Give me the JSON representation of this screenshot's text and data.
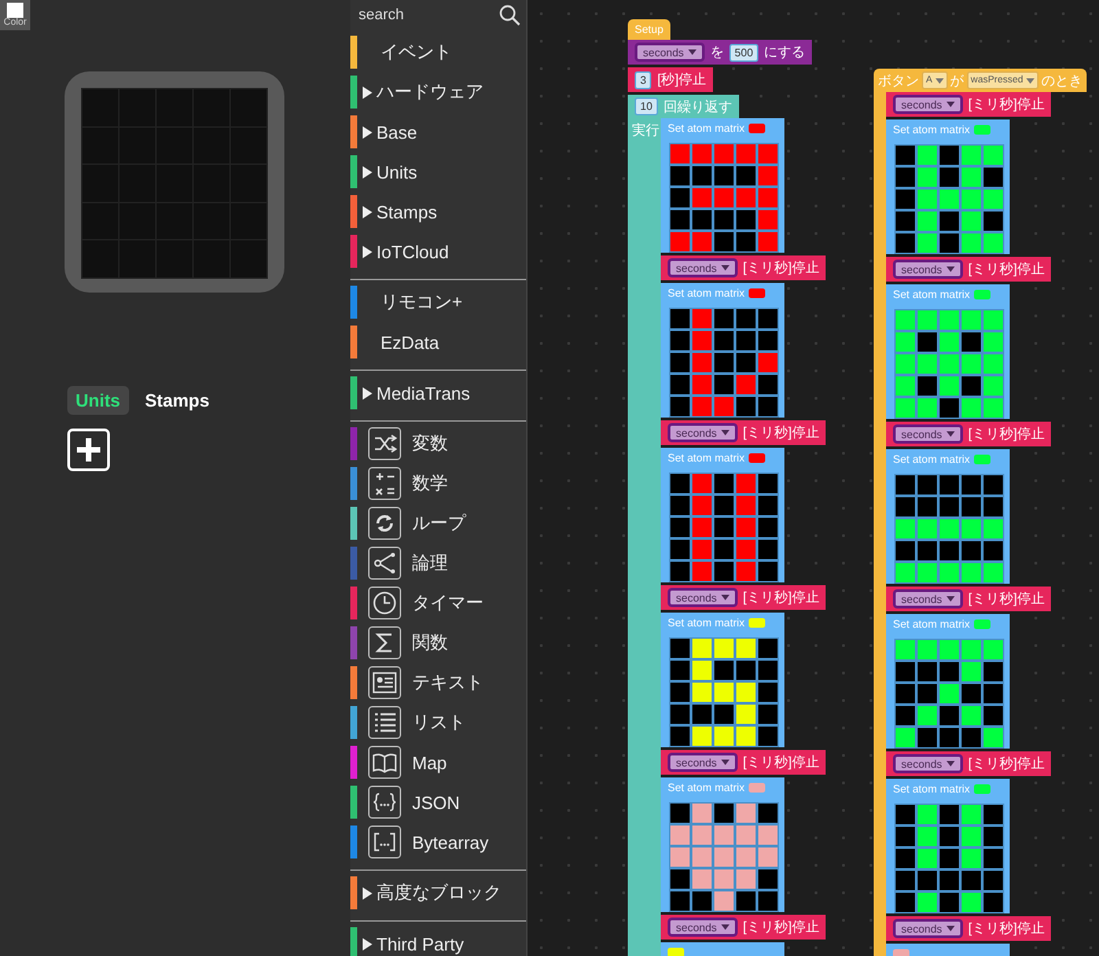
{
  "color_button": {
    "label": "Color"
  },
  "component_tabs": [
    {
      "label": "Units",
      "selected": true
    },
    {
      "label": "Stamps",
      "selected": false
    }
  ],
  "toolbox": {
    "search": {
      "placeholder": "search"
    },
    "groups": [
      {
        "items": [
          {
            "kind": "category",
            "label": "イベント",
            "color": "#f5b83d",
            "expandable": false
          },
          {
            "kind": "category",
            "label": "ハードウェア",
            "color": "#2fbf71",
            "expandable": true
          },
          {
            "kind": "category",
            "label": "Base",
            "color": "#f47b3a",
            "expandable": true
          },
          {
            "kind": "category",
            "label": "Units",
            "color": "#2fbf71",
            "expandable": true
          },
          {
            "kind": "category",
            "label": "Stamps",
            "color": "#f4603a",
            "expandable": true
          },
          {
            "kind": "category",
            "label": "IoTCloud",
            "color": "#e6265c",
            "expandable": true
          }
        ]
      },
      {
        "items": [
          {
            "kind": "category",
            "label": "リモコン+",
            "color": "#1e88e5",
            "expandable": false
          },
          {
            "kind": "category",
            "label": "EzData",
            "color": "#f47b3a",
            "expandable": false
          }
        ]
      },
      {
        "items": [
          {
            "kind": "category",
            "label": "MediaTrans",
            "color": "#2fbf71",
            "expandable": true
          }
        ]
      },
      {
        "items": [
          {
            "kind": "builtin",
            "label": "変数",
            "color": "#8e24aa"
          },
          {
            "kind": "builtin",
            "label": "数学",
            "color": "#3a8fd6"
          },
          {
            "kind": "builtin",
            "label": "ループ",
            "color": "#5cc5b5"
          },
          {
            "kind": "builtin",
            "label": "論理",
            "color": "#3b5ba5"
          },
          {
            "kind": "builtin",
            "label": "タイマー",
            "color": "#e6265c"
          },
          {
            "kind": "builtin",
            "label": "関数",
            "color": "#8e44ad"
          },
          {
            "kind": "builtin",
            "label": "テキスト",
            "color": "#f47b3a"
          },
          {
            "kind": "builtin",
            "label": "リスト",
            "color": "#42a5d5"
          },
          {
            "kind": "builtin",
            "label": "Map",
            "color": "#e020d0"
          },
          {
            "kind": "builtin",
            "label": "JSON",
            "color": "#2fbf71"
          },
          {
            "kind": "builtin",
            "label": "Bytearray",
            "color": "#1e88e5"
          }
        ]
      },
      {
        "items": [
          {
            "kind": "category",
            "label": "高度なブロック",
            "color": "#f47b3a",
            "expandable": true
          }
        ]
      },
      {
        "items": [
          {
            "kind": "category",
            "label": "Third Party",
            "color": "#2fbf71",
            "expandable": true
          }
        ]
      }
    ]
  },
  "workspace": {
    "stacks": [
      {
        "hat": {
          "kind": "setup",
          "label": "Setup"
        },
        "blocks": [
          {
            "kind": "set_variable",
            "variable": "seconds",
            "word": "を",
            "value": "500",
            "suffix": "にする"
          },
          {
            "kind": "wait",
            "value": "3",
            "suffix": "[秒]停止"
          },
          {
            "kind": "repeat",
            "count": "10",
            "suffix": "回繰り返す",
            "do_label": "実行",
            "body": [
              {
                "kind": "atom_matrix",
                "label": "Set atom matrix",
                "color": "#ff0000",
                "cells": [
                  [
                    true,
                    true,
                    true,
                    true,
                    true
                  ],
                  [
                    false,
                    false,
                    false,
                    false,
                    true
                  ],
                  [
                    false,
                    true,
                    true,
                    true,
                    true
                  ],
                  [
                    false,
                    false,
                    false,
                    false,
                    true
                  ],
                  [
                    true,
                    true,
                    false,
                    false,
                    true
                  ]
                ]
              },
              {
                "kind": "wait_ms",
                "variable": "seconds",
                "suffix": "[ミリ秒]停止"
              },
              {
                "kind": "atom_matrix",
                "label": "Set atom matrix",
                "color": "#ff0000",
                "cells": [
                  [
                    false,
                    true,
                    false,
                    false,
                    false
                  ],
                  [
                    false,
                    true,
                    false,
                    false,
                    false
                  ],
                  [
                    false,
                    true,
                    false,
                    false,
                    true
                  ],
                  [
                    false,
                    true,
                    false,
                    true,
                    false
                  ],
                  [
                    false,
                    true,
                    true,
                    false,
                    false
                  ]
                ]
              },
              {
                "kind": "wait_ms",
                "variable": "seconds",
                "suffix": "[ミリ秒]停止"
              },
              {
                "kind": "atom_matrix",
                "label": "Set atom matrix",
                "color": "#ff0000",
                "cells": [
                  [
                    false,
                    true,
                    false,
                    true,
                    false
                  ],
                  [
                    false,
                    true,
                    false,
                    true,
                    false
                  ],
                  [
                    false,
                    true,
                    false,
                    true,
                    false
                  ],
                  [
                    false,
                    true,
                    false,
                    true,
                    false
                  ],
                  [
                    false,
                    true,
                    false,
                    true,
                    false
                  ]
                ]
              },
              {
                "kind": "wait_ms",
                "variable": "seconds",
                "suffix": "[ミリ秒]停止"
              },
              {
                "kind": "atom_matrix",
                "label": "Set atom matrix",
                "color": "#eeff00",
                "cells": [
                  [
                    false,
                    true,
                    true,
                    true,
                    false
                  ],
                  [
                    false,
                    true,
                    false,
                    false,
                    false
                  ],
                  [
                    false,
                    true,
                    true,
                    true,
                    false
                  ],
                  [
                    false,
                    false,
                    false,
                    true,
                    false
                  ],
                  [
                    false,
                    true,
                    true,
                    true,
                    false
                  ]
                ]
              },
              {
                "kind": "wait_ms",
                "variable": "seconds",
                "suffix": "[ミリ秒]停止"
              },
              {
                "kind": "atom_matrix",
                "label": "Set atom matrix",
                "color": "#f0a8a8",
                "cells": [
                  [
                    false,
                    true,
                    false,
                    true,
                    false
                  ],
                  [
                    true,
                    true,
                    true,
                    true,
                    true
                  ],
                  [
                    true,
                    true,
                    true,
                    true,
                    true
                  ],
                  [
                    false,
                    true,
                    true,
                    true,
                    false
                  ],
                  [
                    false,
                    false,
                    true,
                    false,
                    false
                  ]
                ]
              },
              {
                "kind": "wait_ms",
                "variable": "seconds",
                "suffix": "[ミリ秒]停止"
              },
              {
                "kind": "atom_matrix",
                "color": "#eeff00"
              }
            ]
          }
        ]
      },
      {
        "hat": {
          "kind": "button_event",
          "label": "ボタン",
          "button": "A",
          "word": "が",
          "event": "wasPressed",
          "suffix": "のとき"
        },
        "blocks": [
          {
            "kind": "wait_ms",
            "variable": "seconds",
            "suffix": "[ミリ秒]停止"
          },
          {
            "kind": "atom_matrix",
            "label": "Set atom matrix",
            "color": "#00ff40",
            "cells": [
              [
                false,
                true,
                false,
                true,
                true
              ],
              [
                false,
                true,
                false,
                true,
                false
              ],
              [
                false,
                true,
                true,
                true,
                true
              ],
              [
                false,
                true,
                false,
                true,
                false
              ],
              [
                false,
                true,
                false,
                true,
                true
              ]
            ]
          },
          {
            "kind": "wait_ms",
            "variable": "seconds",
            "suffix": "[ミリ秒]停止"
          },
          {
            "kind": "atom_matrix",
            "label": "Set atom matrix",
            "color": "#00ff40",
            "cells": [
              [
                true,
                true,
                true,
                true,
                true
              ],
              [
                true,
                false,
                true,
                false,
                true
              ],
              [
                true,
                true,
                true,
                true,
                true
              ],
              [
                true,
                false,
                true,
                false,
                true
              ],
              [
                true,
                true,
                false,
                true,
                true
              ]
            ]
          },
          {
            "kind": "wait_ms",
            "variable": "seconds",
            "suffix": "[ミリ秒]停止"
          },
          {
            "kind": "atom_matrix",
            "label": "Set atom matrix",
            "color": "#00ff40",
            "cells": [
              [
                false,
                false,
                false,
                false,
                false
              ],
              [
                false,
                false,
                false,
                false,
                false
              ],
              [
                true,
                true,
                true,
                true,
                true
              ],
              [
                false,
                false,
                false,
                false,
                false
              ],
              [
                true,
                true,
                true,
                true,
                true
              ]
            ]
          },
          {
            "kind": "wait_ms",
            "variable": "seconds",
            "suffix": "[ミリ秒]停止"
          },
          {
            "kind": "atom_matrix",
            "label": "Set atom matrix",
            "color": "#00ff40",
            "cells": [
              [
                true,
                true,
                true,
                true,
                true
              ],
              [
                false,
                false,
                false,
                true,
                false
              ],
              [
                false,
                false,
                true,
                false,
                false
              ],
              [
                false,
                true,
                false,
                true,
                false
              ],
              [
                true,
                false,
                false,
                false,
                true
              ]
            ]
          },
          {
            "kind": "wait_ms",
            "variable": "seconds",
            "suffix": "[ミリ秒]停止"
          },
          {
            "kind": "atom_matrix",
            "label": "Set atom matrix",
            "color": "#00ff40",
            "cells": [
              [
                false,
                true,
                false,
                true,
                false
              ],
              [
                false,
                true,
                false,
                true,
                false
              ],
              [
                false,
                true,
                false,
                true,
                false
              ],
              [
                false,
                false,
                false,
                false,
                false
              ],
              [
                false,
                true,
                false,
                true,
                false
              ]
            ]
          },
          {
            "kind": "wait_ms",
            "variable": "seconds",
            "suffix": "[ミリ秒]停止"
          },
          {
            "kind": "atom_matrix",
            "color": "#f0a8a8"
          }
        ]
      }
    ]
  }
}
